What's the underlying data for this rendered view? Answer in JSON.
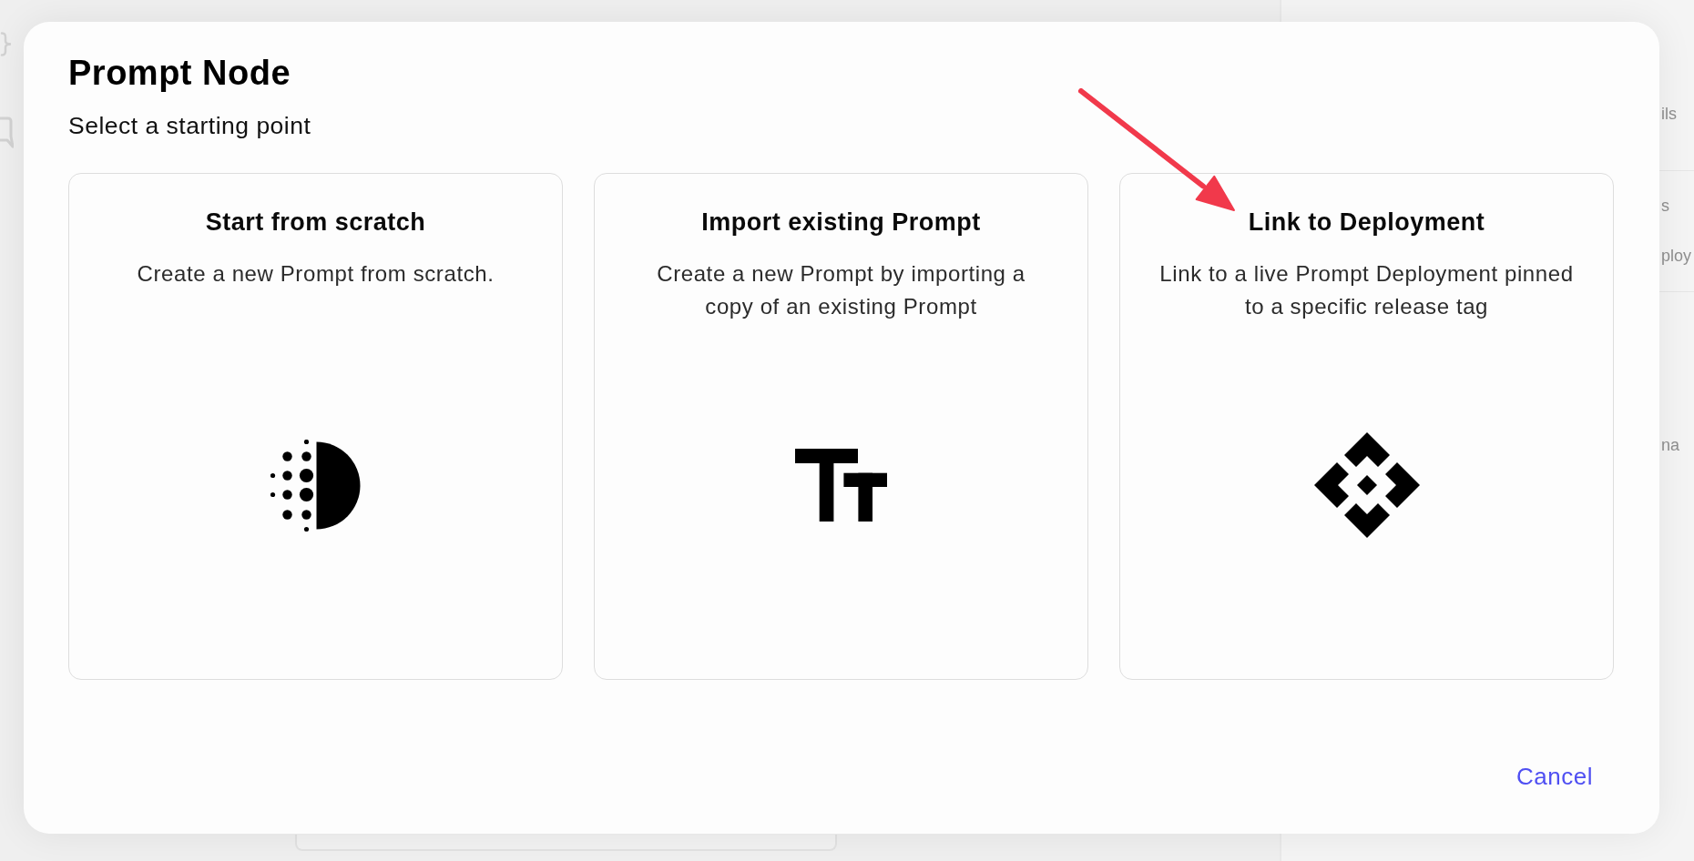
{
  "background": {
    "panel_texts": [
      "ils",
      "s",
      "ploy",
      "na"
    ]
  },
  "dialog": {
    "title": "Prompt Node",
    "subtitle": "Select a starting point",
    "options": [
      {
        "kind": "scratch",
        "title": "Start from scratch",
        "description": "Create a new Prompt from scratch."
      },
      {
        "kind": "import",
        "title": "Import existing Prompt",
        "description": "Create a new Prompt by importing a copy of an existing Prompt"
      },
      {
        "kind": "deployment",
        "title": "Link to Deployment",
        "description": "Link to a live Prompt Deployment pinned to a specific release tag"
      }
    ],
    "cancel_button": "Cancel"
  }
}
